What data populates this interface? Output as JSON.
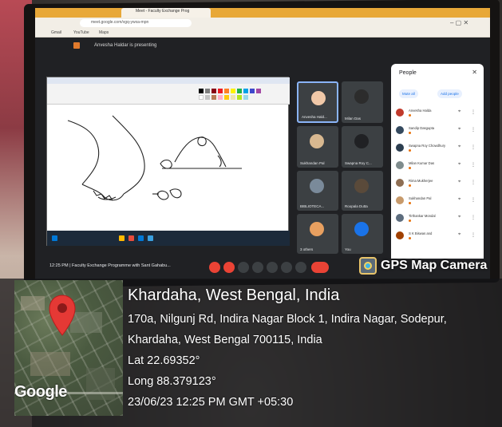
{
  "browser": {
    "tab_title": "Meet - Faculty Exchange Prog",
    "omnibox": "meet.google.com/vgq-ywxa-mpn",
    "bookmarks": [
      "Gmail",
      "YouTube",
      "Maps"
    ],
    "window_controls": "–  ▢  ✕"
  },
  "meet": {
    "presenting_text": "Anvesha Haldar is presenting",
    "bottom_text": "12:25 PM  |  Faculty Exchange Programme with Sant Gahabu...",
    "participants": [
      {
        "name": "Anvesha Hald...",
        "color": "#f0c8a8"
      },
      {
        "name": "Milan Das",
        "color": "#2c2c2c"
      },
      {
        "name": "Sukhandan Pal",
        "color": "#d8b890"
      },
      {
        "name": "Swapna Roy C...",
        "color": "#202124"
      },
      {
        "name": "BIBLIOTECA...",
        "color": "#7a8a9a"
      },
      {
        "name": "Roopala Dutta",
        "color": "#5a4a3a"
      },
      {
        "name": "3 others",
        "color": "#e8a060"
      },
      {
        "name": "You",
        "color": "#1a73e8"
      }
    ]
  },
  "people_panel": {
    "title": "People",
    "close": "✕",
    "mute_all": "Mute all",
    "add_people": "Add people",
    "rows": [
      {
        "name": "Anvesha Halda",
        "color": "#c0392b"
      },
      {
        "name": "Sandip Dasgupta",
        "color": "#34495e"
      },
      {
        "name": "Swapna Roy Chowdhury",
        "color": "#2c3e50"
      },
      {
        "name": "Milan Kumar Das",
        "color": "#7f8c8d"
      },
      {
        "name": "Rima Mukherjee",
        "color": "#8e6e53"
      },
      {
        "name": "Sukhandan Pal",
        "color": "#c79a6b"
      },
      {
        "name": "Tirthankar Mondal",
        "color": "#5d6d7e"
      },
      {
        "name": "S K Biswas and",
        "color": "#a04000"
      }
    ]
  },
  "gps": {
    "app_name": "GPS Map Camera",
    "location_title": "Khardaha, West Bengal, India",
    "address_line_1": "170a, Nilgunj Rd, Indira Nagar Block 1, Indira Nagar, Sodepur,",
    "address_line_2": "Khardaha, West Bengal 700115, India",
    "lat": "Lat 22.69352°",
    "long": "Long 88.379123°",
    "datetime": "23/06/23 12:25 PM GMT +05:30",
    "map_brand": "Google"
  }
}
